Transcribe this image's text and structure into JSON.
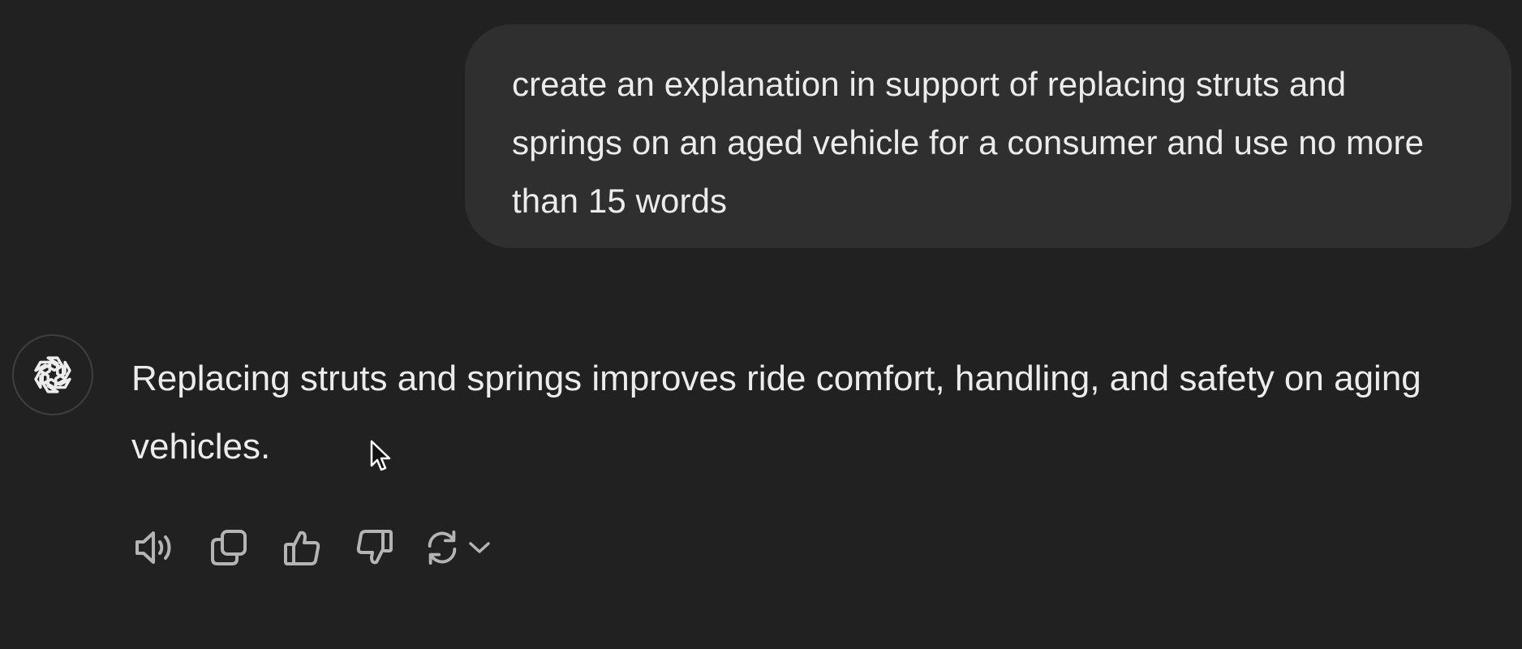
{
  "conversation": {
    "user_message": "create an explanation in support of replacing struts and springs on an aged vehicle for a consumer and use no more than 15 words",
    "assistant_message": "Replacing struts and springs improves ride comfort, handling, and safety on aging vehicles."
  },
  "assistant": {
    "avatar_icon": "openai-logo-icon"
  },
  "actions": [
    {
      "name": "read-aloud-button",
      "icon": "speaker-icon"
    },
    {
      "name": "copy-button",
      "icon": "copy-icon"
    },
    {
      "name": "good-response-button",
      "icon": "thumbs-up-icon"
    },
    {
      "name": "bad-response-button",
      "icon": "thumbs-down-icon"
    },
    {
      "name": "regenerate-button",
      "icon": "refresh-icon"
    }
  ],
  "colors": {
    "background": "#212121",
    "user_bubble": "#2f2f2f",
    "text": "#ececec",
    "icon": "#b4b4b4"
  }
}
